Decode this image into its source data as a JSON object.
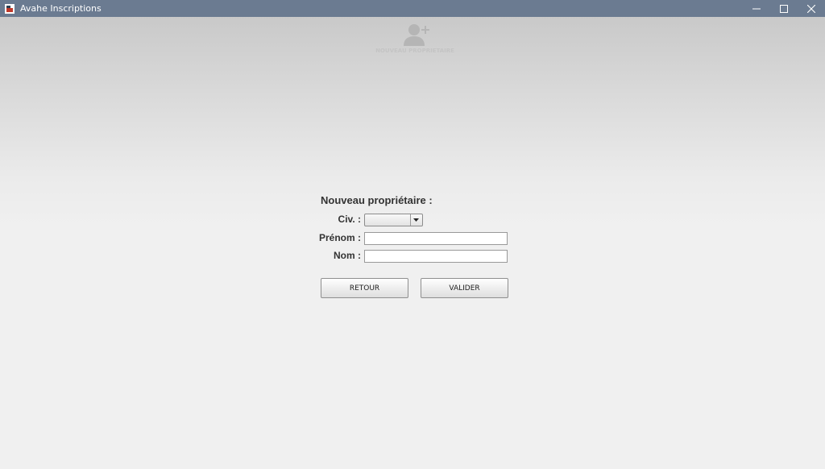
{
  "window": {
    "title": "Avahe Inscriptions",
    "controls": [
      "minimize-icon",
      "maximize-icon",
      "close-icon"
    ]
  },
  "header": {
    "icon": "add-user-icon",
    "label": "NOUVEAU PROPRIETAIRE"
  },
  "form": {
    "title": "Nouveau propriétaire :",
    "civ_label": "Civ. :",
    "civ_value": "",
    "prenom_label": "Prénom :",
    "prenom_value": "",
    "nom_label": "Nom :",
    "nom_value": ""
  },
  "buttons": {
    "retour": "RETOUR",
    "valider": "VALIDER"
  },
  "colors": {
    "titlebar": "#6b7b91",
    "background": "#f0f0f0",
    "header_icon": "#b5b5b5"
  }
}
